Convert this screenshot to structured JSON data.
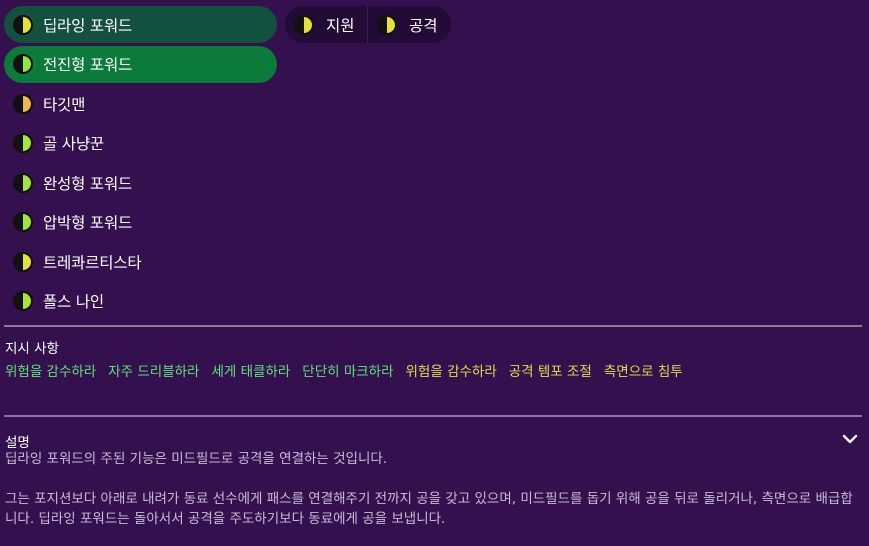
{
  "roles": [
    {
      "label": "딥라잉 포워드",
      "dot_fill": "#e6e238",
      "highlight": "dark"
    },
    {
      "label": "전진형 포워드",
      "dot_fill": "#8fe83a",
      "highlight": "green"
    },
    {
      "label": "타깃맨",
      "dot_fill": "#f0b84a",
      "highlight": "none"
    },
    {
      "label": "골 사냥꾼",
      "dot_fill": "#a8e33a",
      "highlight": "none"
    },
    {
      "label": "완성형 포워드",
      "dot_fill": "#a8e33a",
      "highlight": "none"
    },
    {
      "label": "압박형 포워드",
      "dot_fill": "#a8e33a",
      "highlight": "none"
    },
    {
      "label": "트레콰르티스타",
      "dot_fill": "#e6e238",
      "highlight": "none"
    },
    {
      "label": "폴스 나인",
      "dot_fill": "#a8e33a",
      "highlight": "none"
    }
  ],
  "duties": [
    {
      "label": "지원",
      "dot_fill": "#e6e238"
    },
    {
      "label": "공격",
      "dot_fill": "#e6e238"
    }
  ],
  "instructions": {
    "title": "지시 사항",
    "items": [
      {
        "text": "위험을 감수하라",
        "color": "#5ee27a"
      },
      {
        "text": "자주 드리블하라",
        "color": "#5ee27a"
      },
      {
        "text": "세게 태클하라",
        "color": "#5ee27a"
      },
      {
        "text": "단단히 마크하라",
        "color": "#5ee27a"
      },
      {
        "text": "위험을 감수하라",
        "color": "#d6e04a"
      },
      {
        "text": "공격 템포 조절",
        "color": "#d6e04a"
      },
      {
        "text": "측면으로 침투",
        "color": "#d6e04a"
      }
    ]
  },
  "description": {
    "title": "설명",
    "line1": "딥라잉 포워드의 주된 기능은 미드필드로 공격을 연결하는 것입니다.",
    "line2": "그는 포지션보다 아래로 내려가 동료 선수에게 패스를 연결해주기 전까지 공을 갖고 있으며, 미드필드를 돕기 위해 공을 뒤로 돌리거나, 측면으로 배급합니다. 딥라잉 포워드는 돌아서서 공격을 주도하기보다 동료에게 공을 보냅니다."
  },
  "colors": {
    "background": "#34104f",
    "duty_bg": "#220b36",
    "selected_dark": "#14503f",
    "selected_green": "#0b7a3a",
    "divider": "#8b779e",
    "description_text": "#c9bcd6"
  }
}
